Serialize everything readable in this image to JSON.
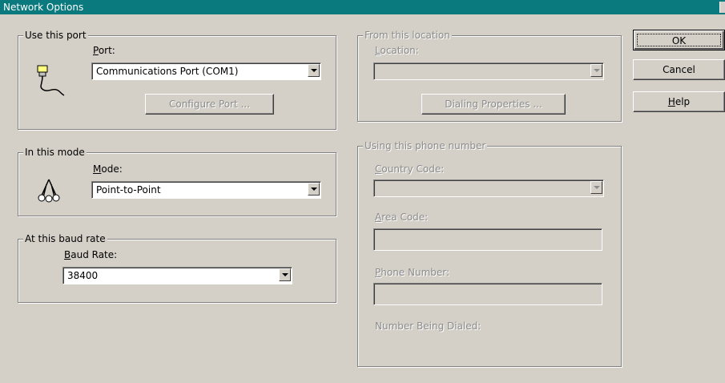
{
  "window": {
    "title": "Network Options"
  },
  "port_group": {
    "legend": "Use this port",
    "port_label_u": "P",
    "port_label_rest": "ort:",
    "port_value": "Communications Port (COM1)",
    "configure_button": "Configure Port ...",
    "icon": "serial-cable-icon"
  },
  "mode_group": {
    "legend": "In this mode",
    "mode_label_u": "M",
    "mode_label_rest": "ode:",
    "mode_value": "Point-to-Point",
    "icon": "network-hands-icon"
  },
  "baud_group": {
    "legend": "At this baud rate",
    "baud_label_u": "B",
    "baud_label_rest": "aud Rate:",
    "baud_value": "38400"
  },
  "location_group": {
    "legend": "From this location",
    "location_label_u": "L",
    "location_label_rest": "ocation:",
    "location_value": "",
    "dialing_button": "Dialing Properties ..."
  },
  "phone_group": {
    "legend": "Using this phone number",
    "country_label_u": "C",
    "country_label_rest": "ountry Code:",
    "area_label_u": "A",
    "area_label_rest": "rea Code:",
    "phone_label_u": "P",
    "phone_label_rest": "hone Number:",
    "dialed_label": "Number Being Dialed:"
  },
  "buttons": {
    "ok": "OK",
    "cancel": "Cancel",
    "help_u": "H",
    "help_rest": "elp"
  }
}
